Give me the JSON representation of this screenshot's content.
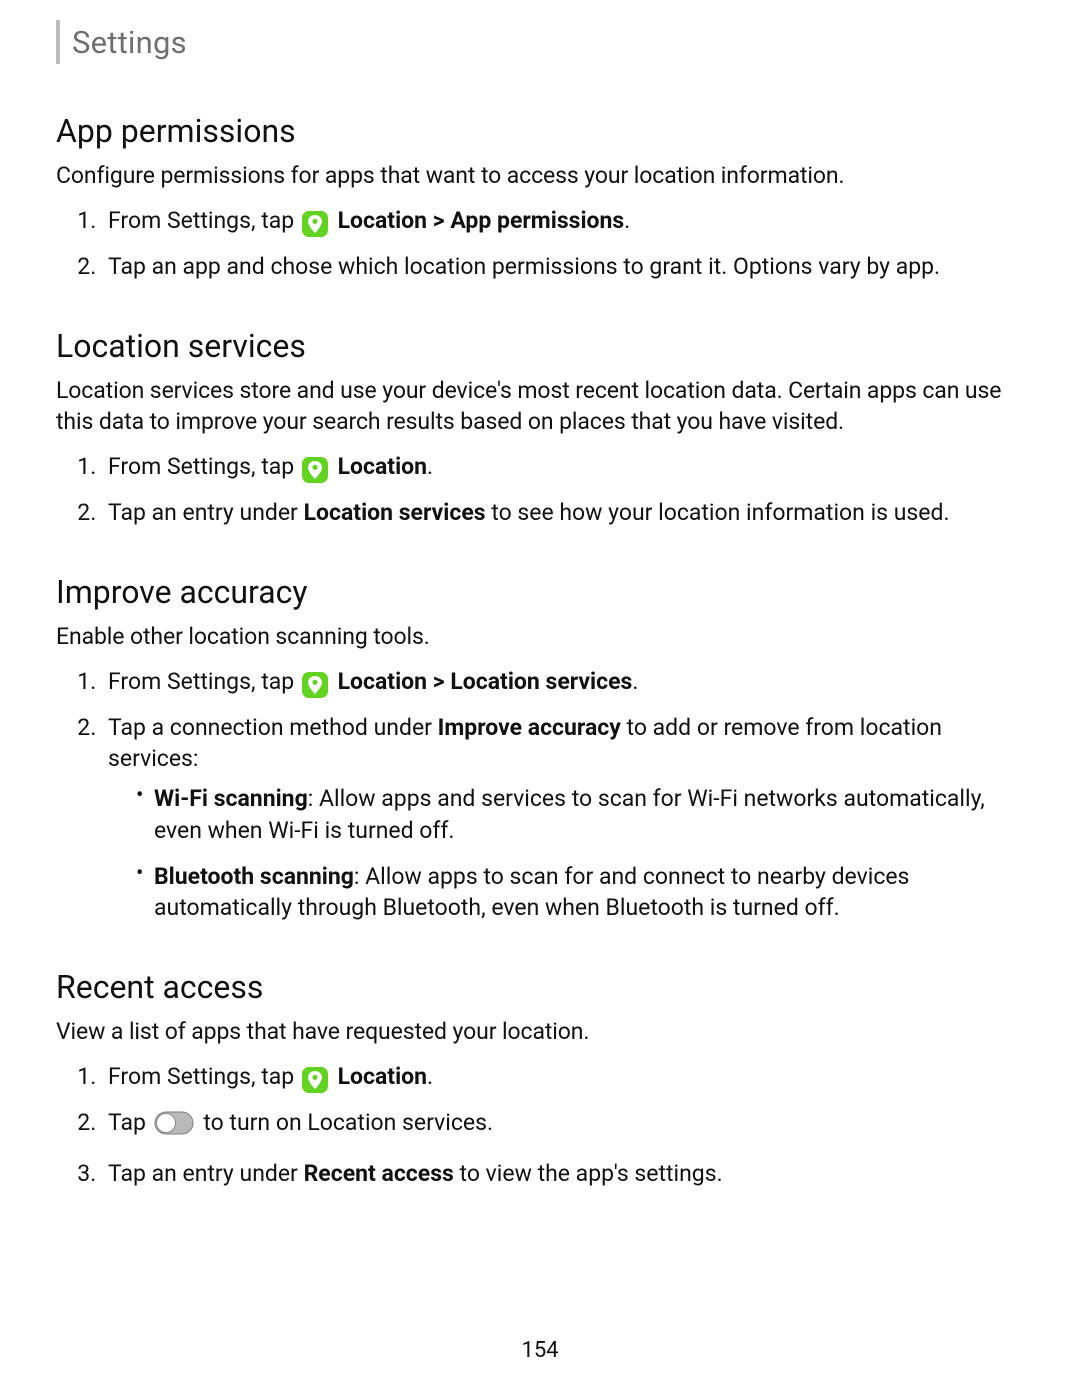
{
  "header": {
    "title": "Settings"
  },
  "page_number": "154",
  "sections": {
    "app_permissions": {
      "title": "App permissions",
      "intro": "Configure permissions for apps that want to access your location information.",
      "step1_pre": "From Settings, tap ",
      "step1_bold": "Location > App permissions",
      "step1_post": ".",
      "step2": "Tap an app and chose which location permissions to grant it. Options vary by app."
    },
    "location_services": {
      "title": "Location services",
      "intro": "Location services store and use your device's most recent location data. Certain apps can use this data to improve your search results based on places that you have visited.",
      "step1_pre": "From Settings, tap ",
      "step1_bold": "Location",
      "step1_post": ".",
      "step2_pre": "Tap an entry under ",
      "step2_bold": "Location services",
      "step2_post": " to see how your location information is used."
    },
    "improve_accuracy": {
      "title": "Improve accuracy",
      "intro": "Enable other location scanning tools.",
      "step1_pre": "From Settings, tap ",
      "step1_bold": "Location > Location services",
      "step1_post": ".",
      "step2_pre": "Tap a connection method under ",
      "step2_bold": "Improve accuracy",
      "step2_post": " to add or remove from location services:",
      "bullet1_bold": "Wi-Fi scanning",
      "bullet1_post": ": Allow apps and services to scan for Wi-Fi networks automatically, even when Wi-Fi is turned off.",
      "bullet2_bold": "Bluetooth scanning",
      "bullet2_post": ": Allow apps to scan for and connect to nearby devices automatically through Bluetooth, even when Bluetooth is turned off."
    },
    "recent_access": {
      "title": "Recent access",
      "intro": "View a list of apps that have requested your location.",
      "step1_pre": "From Settings, tap ",
      "step1_bold": "Location",
      "step1_post": ".",
      "step2_pre": "Tap ",
      "step2_post": " to turn on Location services.",
      "step3_pre": "Tap an entry under ",
      "step3_bold": "Recent access",
      "step3_post": " to view the app's settings."
    }
  }
}
